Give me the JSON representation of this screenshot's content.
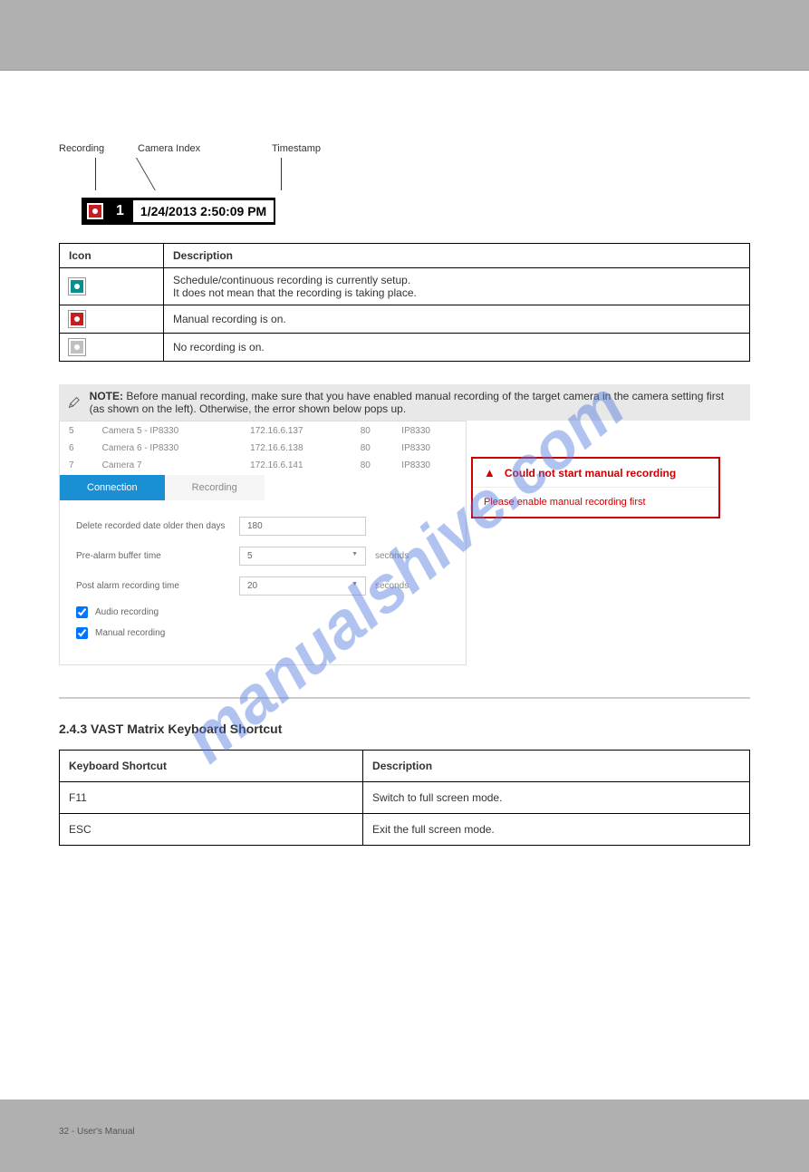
{
  "watermark": "manualshive.com",
  "callout": {
    "label1": "Recording",
    "label2": "Camera Index",
    "label3": "Timestamp"
  },
  "statusbar": {
    "cam_index": "1",
    "timestamp": "1/24/2013 2:50:09 PM"
  },
  "icon_table": {
    "hdr_icon": "Icon",
    "hdr_desc": "Description",
    "row1_desc_1": "Schedule/continuous recording is currently setup.",
    "row1_desc_2": "It does not mean that the recording is taking place.",
    "row2_desc": "Manual recording is on.",
    "row3_desc": "No recording is on."
  },
  "note": {
    "label": "NOTE:",
    "text": "  Before manual recording, make sure that you have enabled manual recording of the target camera in the camera setting first (as shown on the left). Otherwise, the error shown below pops up."
  },
  "camera_table": {
    "rows": [
      {
        "idx": "5",
        "name": "Camera 5 - IP8330",
        "ip": "172.16.6.137",
        "port": "80",
        "model": "IP8330"
      },
      {
        "idx": "6",
        "name": "Camera 6 - IP8330",
        "ip": "172.16.6.138",
        "port": "80",
        "model": "IP8330"
      },
      {
        "idx": "7",
        "name": "Camera 7",
        "ip": "172.16.6.141",
        "port": "80",
        "model": "IP8330"
      }
    ]
  },
  "tabs": {
    "connection": "Connection",
    "recording": "Recording"
  },
  "form": {
    "delete_label": "Delete recorded date older then days",
    "delete_value": "180",
    "prealarm_label": "Pre-alarm buffer time",
    "prealarm_value": "5",
    "postalarm_label": "Post alarm recording time",
    "postalarm_value": "20",
    "seconds": "seconds",
    "audio_recording": "Audio recording",
    "manual_recording": "Manual recording"
  },
  "error": {
    "title": "Could not start manual recording",
    "message": "Please enable manual recording first"
  },
  "section_title": "2.4.3 VAST Matrix Keyboard Shortcut",
  "shortcut_table": {
    "hdr_key": "Keyboard Shortcut",
    "hdr_desc": "Description",
    "row1_key": "F11",
    "row1_desc": "Switch to full screen mode.",
    "row2_key": "ESC",
    "row2_desc": "Exit the full screen mode."
  },
  "footer": {
    "page": "32 - User's Manual"
  }
}
